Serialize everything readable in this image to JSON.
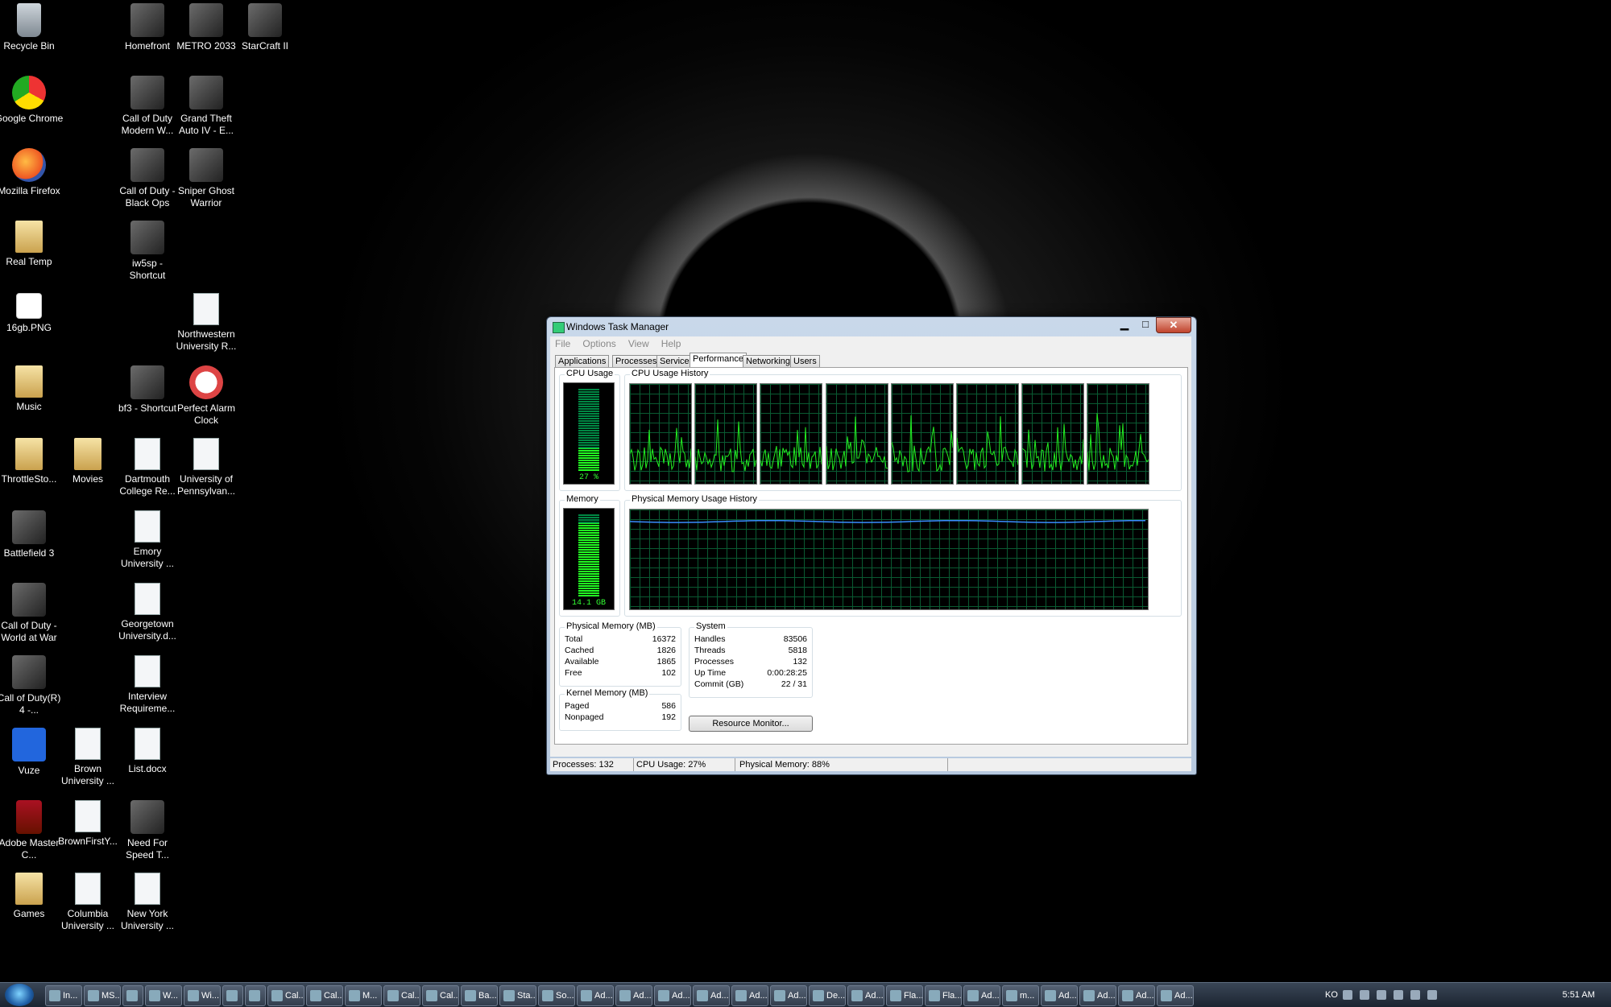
{
  "desktop_icons": [
    {
      "label": "Recycle Bin",
      "icon": "recycle-bin-icon"
    },
    {
      "label": "Google Chrome",
      "icon": "chrome-icon"
    },
    {
      "label": "Mozilla Firefox",
      "icon": "firefox-icon"
    },
    {
      "label": "Real Temp",
      "icon": "folder-icon"
    },
    {
      "label": "16gb.PNG",
      "icon": "image-file-icon"
    },
    {
      "label": "Music",
      "icon": "folder-icon"
    },
    {
      "label": "ThrottleSto...",
      "icon": "folder-icon"
    },
    {
      "label": "Battlefield 3",
      "icon": "game-icon"
    },
    {
      "label": "Call of Duty - World at War",
      "icon": "game-icon"
    },
    {
      "label": "Call of Duty(R) 4 -...",
      "icon": "game-icon"
    },
    {
      "label": "Vuze",
      "icon": "vuze-icon"
    },
    {
      "label": "Adobe Master C...",
      "icon": "adobe-icon"
    },
    {
      "label": "Games",
      "icon": "folder-icon"
    },
    {
      "label": "Movies",
      "icon": "folder-icon"
    },
    {
      "label": "Brown University ...",
      "icon": "document-icon"
    },
    {
      "label": "BrownFirstY...",
      "icon": "document-icon"
    },
    {
      "label": "Columbia University ...",
      "icon": "document-icon"
    },
    {
      "label": "Homefront",
      "icon": "game-icon"
    },
    {
      "label": "Call of Duty Modern W...",
      "icon": "game-icon"
    },
    {
      "label": "Call of Duty - Black Ops",
      "icon": "game-icon"
    },
    {
      "label": "iw5sp - Shortcut",
      "icon": "game-icon"
    },
    {
      "label": "bf3 - Shortcut",
      "icon": "game-icon"
    },
    {
      "label": "Dartmouth College Re...",
      "icon": "document-icon"
    },
    {
      "label": "Emory University ...",
      "icon": "document-icon"
    },
    {
      "label": "Georgetown University.d...",
      "icon": "document-icon"
    },
    {
      "label": "Interview Requireme...",
      "icon": "document-icon"
    },
    {
      "label": "List.docx",
      "icon": "document-icon"
    },
    {
      "label": "Need For Speed T...",
      "icon": "game-icon"
    },
    {
      "label": "New York University ...",
      "icon": "document-icon"
    },
    {
      "label": "METRO 2033",
      "icon": "game-icon"
    },
    {
      "label": "Grand Theft Auto IV - E...",
      "icon": "game-icon"
    },
    {
      "label": "Sniper Ghost Warrior",
      "icon": "game-icon"
    },
    {
      "label": "Northwestern University R...",
      "icon": "document-icon"
    },
    {
      "label": "Perfect Alarm Clock",
      "icon": "clock-icon"
    },
    {
      "label": "University of Pennsylvan...",
      "icon": "document-icon"
    },
    {
      "label": "StarCraft II",
      "icon": "game-icon"
    }
  ],
  "window": {
    "title": "Windows Task Manager",
    "menu": [
      "File",
      "Options",
      "View",
      "Help"
    ],
    "tabs": [
      "Applications",
      "Processes",
      "Services",
      "Performance",
      "Networking",
      "Users"
    ],
    "active_tab": "Performance"
  },
  "performance": {
    "cpu_usage_label": "CPU Usage",
    "cpu_usage_value": "27 %",
    "cpu_usage_fraction": 0.27,
    "cpu_history_label": "CPU Usage History",
    "cpu_cores": 8,
    "memory_label": "Memory",
    "memory_value": "14.1 GB",
    "memory_fraction": 0.88,
    "mem_history_label": "Physical Memory Usage History",
    "physical_memory": {
      "title": "Physical Memory (MB)",
      "rows": [
        [
          "Total",
          "16372"
        ],
        [
          "Cached",
          "1826"
        ],
        [
          "Available",
          "1865"
        ],
        [
          "Free",
          "102"
        ]
      ]
    },
    "kernel_memory": {
      "title": "Kernel Memory (MB)",
      "rows": [
        [
          "Paged",
          "586"
        ],
        [
          "Nonpaged",
          "192"
        ]
      ]
    },
    "system": {
      "title": "System",
      "rows": [
        [
          "Handles",
          "83506"
        ],
        [
          "Threads",
          "5818"
        ],
        [
          "Processes",
          "132"
        ],
        [
          "Up Time",
          "0:00:28:25"
        ],
        [
          "Commit (GB)",
          "22 / 31"
        ]
      ]
    },
    "resource_monitor_button": "Resource Monitor..."
  },
  "statusbar": {
    "processes": "Processes: 132",
    "cpu": "CPU Usage: 27%",
    "memory": "Physical Memory: 88%"
  },
  "taskbar": {
    "items": [
      "In...",
      "MS...",
      "",
      "W...",
      "Wi...",
      "",
      "",
      "Cal...",
      "Cal...",
      "M...",
      "Cal...",
      "Cal...",
      "Ba...",
      "Sta...",
      "So...",
      "Ad...",
      "Ad...",
      "Ad...",
      "Ad...",
      "Ad...",
      "Ad...",
      "De...",
      "Ad...",
      "Fla...",
      "Fla...",
      "Ad...",
      "m...",
      "Ad...",
      "Ad...",
      "Ad...",
      "Ad..."
    ],
    "tray_lang": "KO",
    "clock": "5:51 AM"
  },
  "colors": {
    "graph_line": "#22ee22",
    "memory_line": "#3a8cff",
    "grid": "#0a5a32"
  }
}
